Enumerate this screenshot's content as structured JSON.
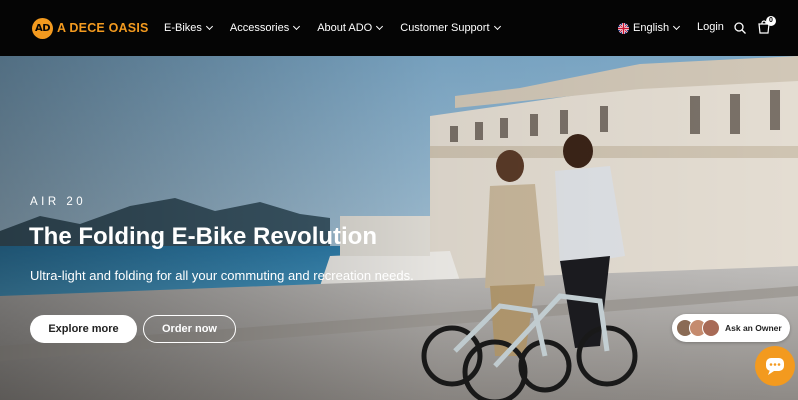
{
  "brand": {
    "logo_monogram": "AD",
    "name": "A DECE OASIS",
    "accent_color": "#f39a1f"
  },
  "nav": {
    "items": [
      {
        "label": "E-Bikes"
      },
      {
        "label": "Accessories"
      },
      {
        "label": "About ADO"
      },
      {
        "label": "Customer Support"
      }
    ],
    "language": "English",
    "login": "Login",
    "cart_count": "0",
    "icons": {
      "search": "search-icon",
      "cart": "cart-icon",
      "language": "uk-flag-icon",
      "dropdown": "chevron-down-icon"
    }
  },
  "hero": {
    "eyebrow": "AIR 20",
    "headline": "The Folding E-Bike Revolution",
    "subline": "Ultra-light and folding for all your commuting and recreation needs.",
    "primary_cta": "Explore more",
    "secondary_cta": "Order now"
  },
  "widgets": {
    "ask_owner": "Ask an Owner",
    "chat_icon": "chat-bubble-icon"
  }
}
